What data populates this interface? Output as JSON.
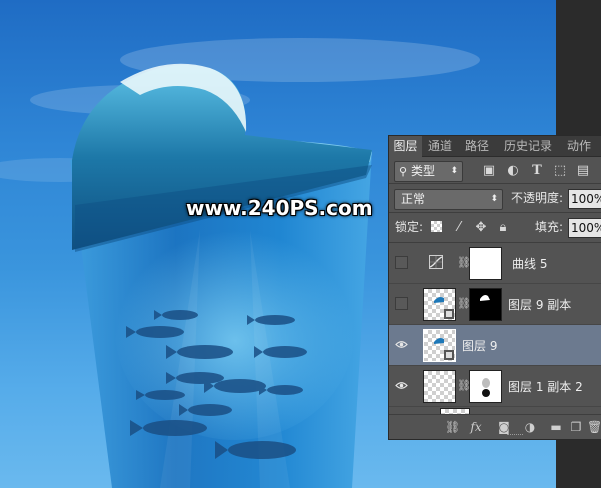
{
  "watermark": "www.240PS.com",
  "layers_panel": {
    "tabs": [
      "图层",
      "通道",
      "路径",
      "历史记录",
      "动作"
    ],
    "filter_kind": "类型",
    "filter_icons": [
      "image-filter-icon",
      "adjustment-filter-icon",
      "type-filter-icon",
      "shape-filter-icon",
      "smart-object-filter-icon"
    ],
    "blend_mode": "正常",
    "opacity_label": "不透明度:",
    "opacity_value": "100%",
    "lock_label": "锁定:",
    "fill_label": "填充:",
    "fill_value": "100%",
    "layers": [
      {
        "name": "曲线 5",
        "visible": false,
        "selected": false,
        "kind": "curves-adjustment"
      },
      {
        "name": "图层 9 副本",
        "visible": false,
        "selected": false,
        "kind": "masked-layer"
      },
      {
        "name": "图层 9",
        "visible": true,
        "selected": true,
        "kind": "layer"
      },
      {
        "name": "图层 1 副本 2",
        "visible": true,
        "selected": false,
        "kind": "masked-layer"
      }
    ],
    "bottom_icons": [
      "link-icon",
      "fx-icon",
      "add-mask-icon",
      "adjustment-icon",
      "group-folder-icon",
      "new-layer-icon",
      "trash-icon"
    ],
    "fx_label": "fx"
  },
  "colors": {
    "sky_top": "#1f6cc4",
    "sky_bottom": "#6ab9ee",
    "panel_bg": "#535353",
    "selected_row": "#6c7a8f"
  }
}
